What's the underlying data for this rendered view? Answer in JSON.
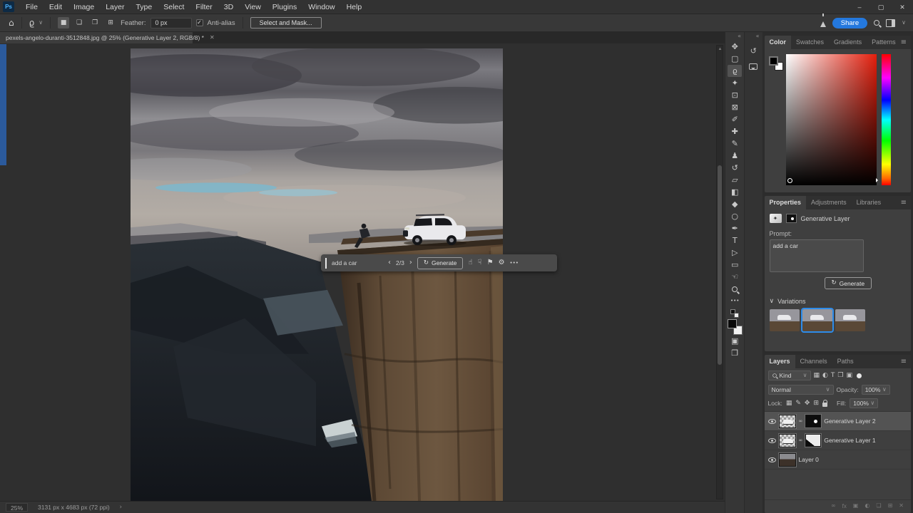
{
  "app": {
    "logo": "Ps",
    "window_controls": {
      "minimize": "–",
      "maximize": "▢",
      "close": "✕"
    }
  },
  "menubar": {
    "items": [
      "File",
      "Edit",
      "Image",
      "Layer",
      "Type",
      "Select",
      "Filter",
      "3D",
      "View",
      "Plugins",
      "Window",
      "Help"
    ]
  },
  "options_bar": {
    "home_icon": "⌂",
    "tool_icon": "ϱ",
    "dropdown_chevron": "∨",
    "modes": [
      "■",
      "❏",
      "❐",
      "⊞"
    ],
    "feather_label": "Feather:",
    "feather_value": "0 px",
    "check_glyph": "✓",
    "antialias_label": "Anti-alias",
    "select_mask_label": "Select and Mask...",
    "share_label": "Share"
  },
  "document_tab": {
    "title": "pexels-angelo-duranti-3512848.jpg @ 25% (Generative Layer 2, RGB/8) *",
    "close_icon": "✕"
  },
  "taskbar": {
    "prompt_value": "add a car",
    "prev_icon": "‹",
    "counter": "2/3",
    "next_icon": "›",
    "generate_icon": "↻",
    "generate_label": "Generate",
    "like_icon": "☝",
    "dislike_icon": "☟",
    "flag_icon": "⚑",
    "settings_icon": "⚙",
    "more_icon": "•••"
  },
  "toolbar": {
    "collapse_icon": "«",
    "tools": [
      {
        "name": "move",
        "glyph": "✥"
      },
      {
        "name": "rectangular-marquee",
        "glyph": "▢"
      },
      {
        "name": "lasso",
        "glyph": "ϱ"
      },
      {
        "name": "magic-wand",
        "glyph": "✦"
      },
      {
        "name": "crop",
        "glyph": "⊡"
      },
      {
        "name": "frame",
        "glyph": "⊠"
      },
      {
        "name": "eyedropper",
        "glyph": "✐"
      },
      {
        "name": "spot-healing",
        "glyph": "✚"
      },
      {
        "name": "brush",
        "glyph": "✎"
      },
      {
        "name": "clone-stamp",
        "glyph": "♟"
      },
      {
        "name": "history-brush",
        "glyph": "↺"
      },
      {
        "name": "eraser",
        "glyph": "▱"
      },
      {
        "name": "gradient",
        "glyph": "◧"
      },
      {
        "name": "blur",
        "glyph": "◆"
      },
      {
        "name": "dodge",
        "glyph": "○"
      },
      {
        "name": "pen",
        "glyph": "✒"
      },
      {
        "name": "type",
        "glyph": "T"
      },
      {
        "name": "path-select",
        "glyph": "▷"
      },
      {
        "name": "rectangle",
        "glyph": "▭"
      },
      {
        "name": "hand",
        "glyph": "☜"
      },
      {
        "name": "zoom",
        "glyph": ""
      },
      {
        "name": "edit-toolbar",
        "glyph": "•••"
      }
    ],
    "quickmask_icon": "▣",
    "screenmode_icon": "❐"
  },
  "dock": {
    "collapse_icon": "«",
    "history_icon": "↺"
  },
  "panels": {
    "color": {
      "tabs": [
        "Color",
        "Swatches",
        "Gradients",
        "Patterns"
      ],
      "menu_icon": "≡"
    },
    "properties": {
      "tabs": [
        "Properties",
        "Adjustments",
        "Libraries"
      ],
      "menu_icon": "≡",
      "gen_icon": "✦",
      "layer_badge": "Generative Layer",
      "prompt_label": "Prompt:",
      "prompt_value": "add a car",
      "generate_icon": "↻",
      "generate_label": "Generate",
      "variations_chevron": "∨",
      "variations_label": "Variations"
    },
    "layers": {
      "tabs": [
        "Layers",
        "Channels",
        "Paths"
      ],
      "menu_icon": "≡",
      "kind_label": "Kind",
      "dropdown_chevron": "∨",
      "filter_icons": [
        "▦",
        "◐",
        "T",
        "❒",
        "▣"
      ],
      "blend_mode": "Normal",
      "opacity_label": "Opacity:",
      "opacity_value": "100%",
      "lock_label": "Lock:",
      "lock_icons": [
        "▦",
        "✎",
        "✥",
        "⊞"
      ],
      "fill_label": "Fill:",
      "fill_value": "100%",
      "link_icon": "∞",
      "rows": [
        {
          "name": "Generative Layer 2"
        },
        {
          "name": "Generative Layer 1"
        },
        {
          "name": "Layer 0"
        }
      ],
      "footer_icons": [
        "∞",
        "fx",
        "▣",
        "◐",
        "❏",
        "⊞",
        "✕"
      ]
    }
  },
  "status_bar": {
    "zoom": "25%",
    "doc_info": "3131 px x 4683 px (72 ppi)",
    "chevron": "›"
  },
  "colors": {
    "accent_blue": "#2478dd",
    "selection_blue": "#2d8ceb",
    "pasteboard": "#2f2f2f",
    "panel_bg": "#3f3f3f"
  }
}
